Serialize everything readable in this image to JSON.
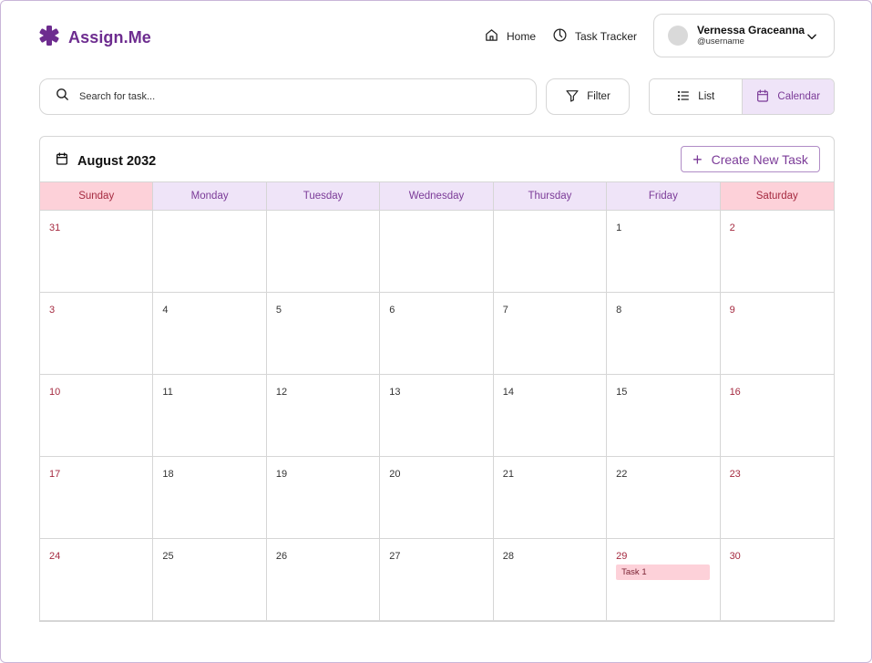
{
  "app": {
    "name": "Assign.Me",
    "logo_icon": "asterisk-logo-icon",
    "brand_color": "#6d2c8f"
  },
  "nav": {
    "home_label": "Home",
    "home_icon": "home-icon",
    "tracker_label": "Task Tracker",
    "tracker_icon": "timer-icon"
  },
  "user": {
    "name": "Vernessa Graceanna",
    "handle": "@username"
  },
  "toolbar": {
    "search_placeholder": "Search for task...",
    "filter_label": "Filter",
    "view_list_label": "List",
    "view_calendar_label": "Calendar",
    "active_view": "Calendar"
  },
  "calendar": {
    "month_label": "August 2032",
    "create_label": "Create New Task",
    "weekdays": [
      "Sunday",
      "Monday",
      "Tuesday",
      "Wednesday",
      "Thursday",
      "Friday",
      "Saturday"
    ],
    "weeks": [
      [
        "31",
        "",
        "",
        "",
        "",
        "1",
        "2"
      ],
      [
        "3",
        "4",
        "5",
        "6",
        "7",
        "8",
        "9"
      ],
      [
        "10",
        "11",
        "12",
        "13",
        "14",
        "15",
        "16"
      ],
      [
        "17",
        "18",
        "19",
        "20",
        "21",
        "22",
        "23"
      ],
      [
        "24",
        "25",
        "26",
        "27",
        "28",
        "29",
        "30"
      ]
    ],
    "tasks": [
      {
        "date": "29",
        "label": "Task 1"
      }
    ],
    "colors": {
      "weekday_header_bg": "#efe4f8",
      "weekday_header_text": "#7b3b98",
      "weekend_header_bg": "#fdd1d9",
      "weekend_text": "#a52a40",
      "task_bg": "#fdd1d9"
    }
  }
}
